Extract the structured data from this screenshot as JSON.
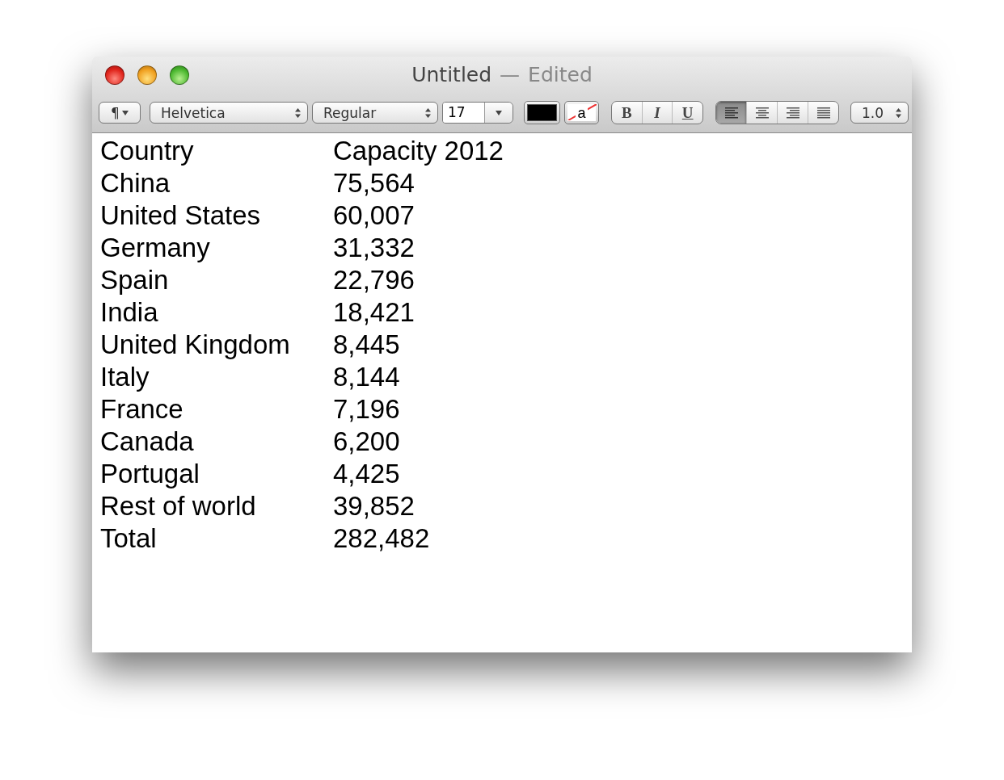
{
  "window": {
    "title": "Untitled",
    "separator": "—",
    "status": "Edited"
  },
  "toolbar": {
    "paragraph": "¶",
    "font": "Helvetica",
    "typeface": "Regular",
    "size": "17",
    "text_color_well": {
      "color": "#000000"
    },
    "highlight_label": "a",
    "styles": [
      {
        "label": "B",
        "kind": "bold"
      },
      {
        "label": "I",
        "kind": "italic"
      },
      {
        "label": "U",
        "kind": "underline"
      }
    ],
    "alignment": [
      {
        "kind": "left",
        "selected": true
      },
      {
        "kind": "center",
        "selected": false
      },
      {
        "kind": "right",
        "selected": false
      },
      {
        "kind": "justify",
        "selected": false
      }
    ],
    "spacing": "1.0"
  },
  "document": {
    "rows": [
      [
        "Country",
        "Capacity 2012"
      ],
      [
        "China",
        "75,564"
      ],
      [
        "United States",
        "60,007"
      ],
      [
        "Germany",
        "31,332"
      ],
      [
        "Spain",
        "22,796"
      ],
      [
        "India",
        "18,421"
      ],
      [
        "United Kingdom",
        "8,445"
      ],
      [
        "Italy",
        "8,144"
      ],
      [
        "France",
        "7,196"
      ],
      [
        "Canada",
        "6,200"
      ],
      [
        "Portugal",
        "4,425"
      ],
      [
        "Rest of world",
        "39,852"
      ],
      [
        "Total",
        "282,482"
      ]
    ]
  }
}
